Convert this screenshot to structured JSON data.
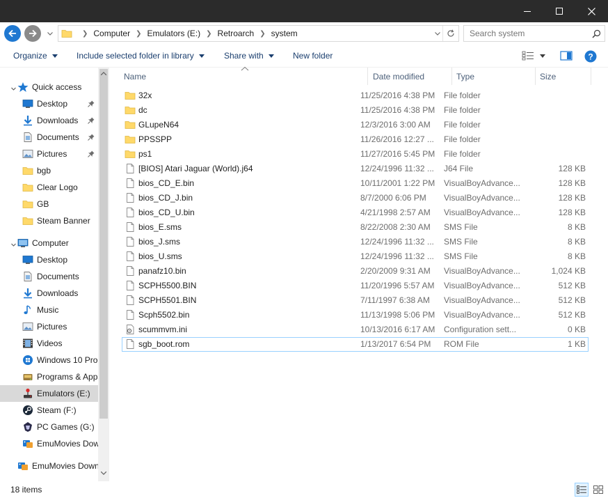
{
  "window": {
    "minimize_label": "Minimize",
    "maximize_label": "Maximize",
    "close_label": "Close"
  },
  "address": {
    "crumbs": [
      "Computer",
      "Emulators (E:)",
      "Retroarch",
      "system"
    ],
    "search_placeholder": "Search system"
  },
  "toolbar": {
    "organize": "Organize",
    "include": "Include selected folder in library",
    "share": "Share with",
    "new_folder": "New folder"
  },
  "nav": {
    "quick_access": "Quick access",
    "quick_items": [
      {
        "label": "Desktop",
        "icon": "desktop-icon",
        "pinned": true
      },
      {
        "label": "Downloads",
        "icon": "downloads-icon",
        "pinned": true
      },
      {
        "label": "Documents",
        "icon": "documents-icon",
        "pinned": true
      },
      {
        "label": "Pictures",
        "icon": "pictures-icon",
        "pinned": true
      },
      {
        "label": "bgb",
        "icon": "folder-icon",
        "pinned": false
      },
      {
        "label": "Clear Logo",
        "icon": "folder-icon",
        "pinned": false
      },
      {
        "label": "GB",
        "icon": "folder-icon",
        "pinned": false
      },
      {
        "label": "Steam Banner",
        "icon": "folder-icon",
        "pinned": false
      }
    ],
    "computer": "Computer",
    "computer_items": [
      {
        "label": "Desktop",
        "icon": "desktop-icon"
      },
      {
        "label": "Documents",
        "icon": "documents-icon"
      },
      {
        "label": "Downloads",
        "icon": "downloads-icon"
      },
      {
        "label": "Music",
        "icon": "music-icon"
      },
      {
        "label": "Pictures",
        "icon": "pictures-icon"
      },
      {
        "label": "Videos",
        "icon": "videos-icon"
      },
      {
        "label": "Windows 10 Pro",
        "icon": "windows-drive-icon"
      },
      {
        "label": "Programs & Apps",
        "icon": "drive-icon"
      },
      {
        "label": "Emulators (E:)",
        "icon": "joystick-drive-icon",
        "selected": true
      },
      {
        "label": "Steam (F:)",
        "icon": "steam-drive-icon"
      },
      {
        "label": "PC Games (G:)",
        "icon": "pcgames-drive-icon"
      },
      {
        "label": "EmuMovies Dow",
        "icon": "network-drive-icon"
      }
    ],
    "network_item": "EmuMovies Down"
  },
  "columns": {
    "name": "Name",
    "date": "Date modified",
    "type": "Type",
    "size": "Size"
  },
  "files": [
    {
      "name": "32x",
      "date": "11/25/2016 4:38 PM",
      "type": "File folder",
      "size": "",
      "kind": "folder"
    },
    {
      "name": "dc",
      "date": "11/25/2016 4:38 PM",
      "type": "File folder",
      "size": "",
      "kind": "folder"
    },
    {
      "name": "GLupeN64",
      "date": "12/3/2016 3:00 AM",
      "type": "File folder",
      "size": "",
      "kind": "folder"
    },
    {
      "name": "PPSSPP",
      "date": "11/26/2016 12:27 ...",
      "type": "File folder",
      "size": "",
      "kind": "folder"
    },
    {
      "name": "ps1",
      "date": "11/27/2016 5:45 PM",
      "type": "File folder",
      "size": "",
      "kind": "folder"
    },
    {
      "name": "[BIOS] Atari Jaguar (World).j64",
      "date": "12/24/1996 11:32 ...",
      "type": "J64 File",
      "size": "128 KB",
      "kind": "file"
    },
    {
      "name": "bios_CD_E.bin",
      "date": "10/11/2001 1:22 PM",
      "type": "VisualBoyAdvance...",
      "size": "128 KB",
      "kind": "file"
    },
    {
      "name": "bios_CD_J.bin",
      "date": "8/7/2000 6:06 PM",
      "type": "VisualBoyAdvance...",
      "size": "128 KB",
      "kind": "file"
    },
    {
      "name": "bios_CD_U.bin",
      "date": "4/21/1998 2:57 AM",
      "type": "VisualBoyAdvance...",
      "size": "128 KB",
      "kind": "file"
    },
    {
      "name": "bios_E.sms",
      "date": "8/22/2008 2:30 AM",
      "type": "SMS File",
      "size": "8 KB",
      "kind": "file"
    },
    {
      "name": "bios_J.sms",
      "date": "12/24/1996 11:32 ...",
      "type": "SMS File",
      "size": "8 KB",
      "kind": "file"
    },
    {
      "name": "bios_U.sms",
      "date": "12/24/1996 11:32 ...",
      "type": "SMS File",
      "size": "8 KB",
      "kind": "file"
    },
    {
      "name": "panafz10.bin",
      "date": "2/20/2009 9:31 AM",
      "type": "VisualBoyAdvance...",
      "size": "1,024 KB",
      "kind": "file"
    },
    {
      "name": "SCPH5500.BIN",
      "date": "11/20/1996 5:57 AM",
      "type": "VisualBoyAdvance...",
      "size": "512 KB",
      "kind": "file"
    },
    {
      "name": "SCPH5501.BIN",
      "date": "7/11/1997 6:38 AM",
      "type": "VisualBoyAdvance...",
      "size": "512 KB",
      "kind": "file"
    },
    {
      "name": "Scph5502.bin",
      "date": "11/13/1998 5:06 PM",
      "type": "VisualBoyAdvance...",
      "size": "512 KB",
      "kind": "file"
    },
    {
      "name": "scummvm.ini",
      "date": "10/13/2016 6:17 AM",
      "type": "Configuration sett...",
      "size": "0 KB",
      "kind": "config"
    },
    {
      "name": "sgb_boot.rom",
      "date": "1/13/2017 6:54 PM",
      "type": "ROM File",
      "size": "1 KB",
      "kind": "file",
      "selected": true
    }
  ],
  "status": {
    "count": "18 items"
  },
  "colors": {
    "accent": "#1f78d1",
    "folder": "#ffd96a",
    "selection_border": "#99d1ff",
    "titlebar": "#2b2b2b"
  }
}
